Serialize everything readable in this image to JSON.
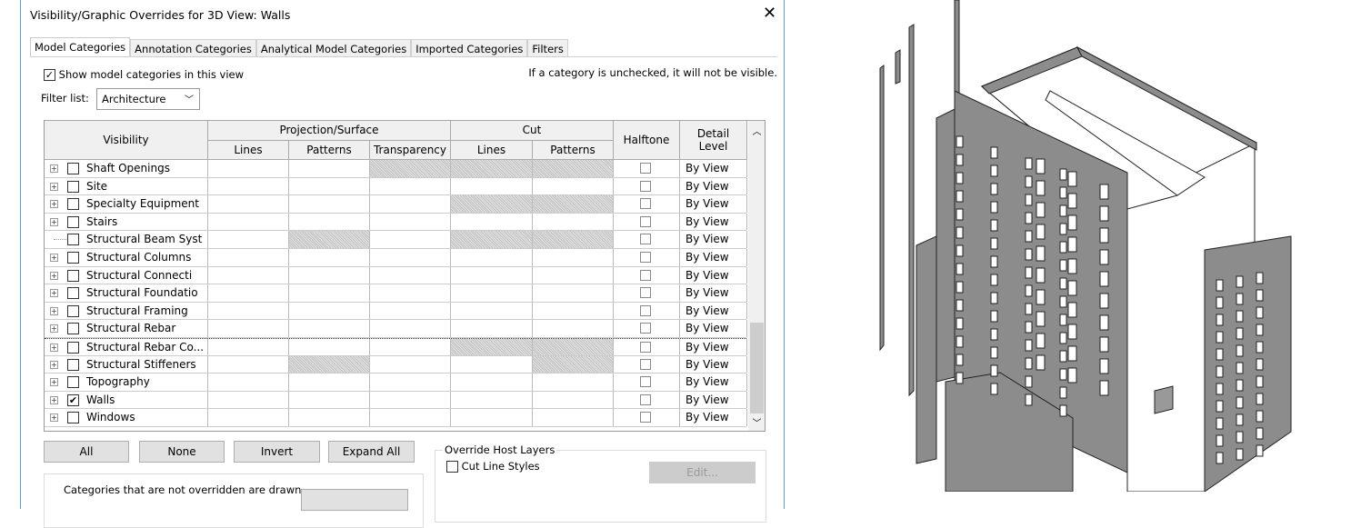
{
  "dialog": {
    "title": "Visibility/Graphic Overrides for 3D View: Walls",
    "close_icon": "close-icon"
  },
  "tabs": [
    "Model Categories",
    "Annotation Categories",
    "Analytical Model Categories",
    "Imported Categories",
    "Filters"
  ],
  "active_tab": 0,
  "show_categories": {
    "label": "Show model categories in this view",
    "checked": true
  },
  "hint": "If a category is unchecked, it will not be visible.",
  "filter": {
    "label": "Filter list:",
    "value": "Architecture"
  },
  "table": {
    "headers": {
      "visibility": "Visibility",
      "projection": "Projection/Surface",
      "cut": "Cut",
      "lines": "Lines",
      "patterns": "Patterns",
      "transparency": "Transparency",
      "halftone": "Halftone",
      "detail_level": "Detail Level"
    },
    "rows": [
      {
        "name": "Shaft Openings",
        "checked": false,
        "expand": true,
        "shaded": [
          "transparency",
          "cut_lines",
          "cut_patterns"
        ],
        "halftone": false,
        "detail": "By View"
      },
      {
        "name": "Site",
        "checked": false,
        "expand": true,
        "shaded": [],
        "halftone": false,
        "detail": "By View"
      },
      {
        "name": "Specialty Equipment",
        "checked": false,
        "expand": true,
        "shaded": [
          "cut_lines",
          "cut_patterns"
        ],
        "halftone": false,
        "detail": "By View"
      },
      {
        "name": "Stairs",
        "checked": false,
        "expand": true,
        "shaded": [],
        "halftone": false,
        "detail": "By View"
      },
      {
        "name": "Structural Beam Syst",
        "checked": false,
        "expand": false,
        "shaded": [
          "proj_patterns",
          "cut_lines",
          "cut_patterns"
        ],
        "halftone": false,
        "detail": "By View"
      },
      {
        "name": "Structural Columns",
        "checked": false,
        "expand": true,
        "shaded": [],
        "halftone": false,
        "detail": "By View"
      },
      {
        "name": "Structural Connecti",
        "checked": false,
        "expand": true,
        "shaded": [],
        "halftone": false,
        "detail": "By View"
      },
      {
        "name": "Structural Foundatio",
        "checked": false,
        "expand": true,
        "shaded": [],
        "halftone": false,
        "detail": "By View"
      },
      {
        "name": "Structural Framing",
        "checked": false,
        "expand": true,
        "shaded": [],
        "halftone": false,
        "detail": "By View"
      },
      {
        "name": "Structural Rebar",
        "checked": false,
        "expand": true,
        "shaded": [],
        "halftone": false,
        "detail": "By View"
      },
      {
        "name": "Structural Rebar Co...",
        "checked": false,
        "expand": true,
        "shaded": [
          "cut_lines",
          "cut_patterns"
        ],
        "halftone": false,
        "detail": "By View"
      },
      {
        "name": "Structural Stiffeners",
        "checked": false,
        "expand": true,
        "shaded": [
          "proj_patterns",
          "cut_patterns"
        ],
        "halftone": false,
        "detail": "By View"
      },
      {
        "name": "Topography",
        "checked": false,
        "expand": true,
        "shaded": [],
        "halftone": false,
        "detail": "By View"
      },
      {
        "name": "Walls",
        "checked": true,
        "expand": true,
        "shaded": [],
        "halftone": false,
        "detail": "By View"
      },
      {
        "name": "Windows",
        "checked": false,
        "expand": true,
        "shaded": [],
        "halftone": false,
        "detail": "By View"
      }
    ]
  },
  "buttons": {
    "all": "All",
    "none": "None",
    "invert": "Invert",
    "expand_all": "Expand All"
  },
  "override_host": {
    "label": "Override Host Layers",
    "cut_line_styles": "Cut Line Styles",
    "edit": "Edit..."
  },
  "footer_text": "Categories that are not overridden are drawn",
  "colors": {
    "accent": "#6a9ad0",
    "building": "#8c8c8c"
  }
}
